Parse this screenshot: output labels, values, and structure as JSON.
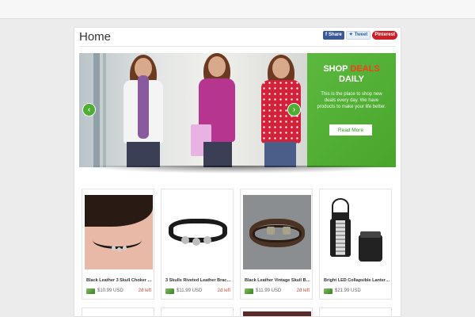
{
  "page": {
    "title": "Home"
  },
  "share": {
    "facebook_label": "Share",
    "twitter_label": "Tweet",
    "pinterest_label": "Pinterest"
  },
  "banner": {
    "headline_part1": "SHOP ",
    "headline_highlight": "DEALS",
    "headline_part2": "DAILY",
    "description": "This is the place to shop new deals every day. We have products to make your life better.",
    "button_label": "Read More",
    "prev_arrow": "‹",
    "next_arrow": "›"
  },
  "products": [
    {
      "name": "Black Leather 3 Skull Choker N...",
      "price": "$10.99 USD",
      "left": "2d left"
    },
    {
      "name": "3 Skulls Riveted Leather Bracelet",
      "price": "$11.99 USD",
      "left": "2d left"
    },
    {
      "name": "Black Leather Vintage Skull Bra...",
      "price": "$11.99 USD",
      "left": "2d left"
    },
    {
      "name": "Bright LED Collapsible Lantern-...",
      "price": "$21.99 USD",
      "left": ""
    }
  ],
  "colors": {
    "accent_green": "#4caf2f",
    "deal_red": "#ff3a1a",
    "left_red": "#d24b3a"
  }
}
